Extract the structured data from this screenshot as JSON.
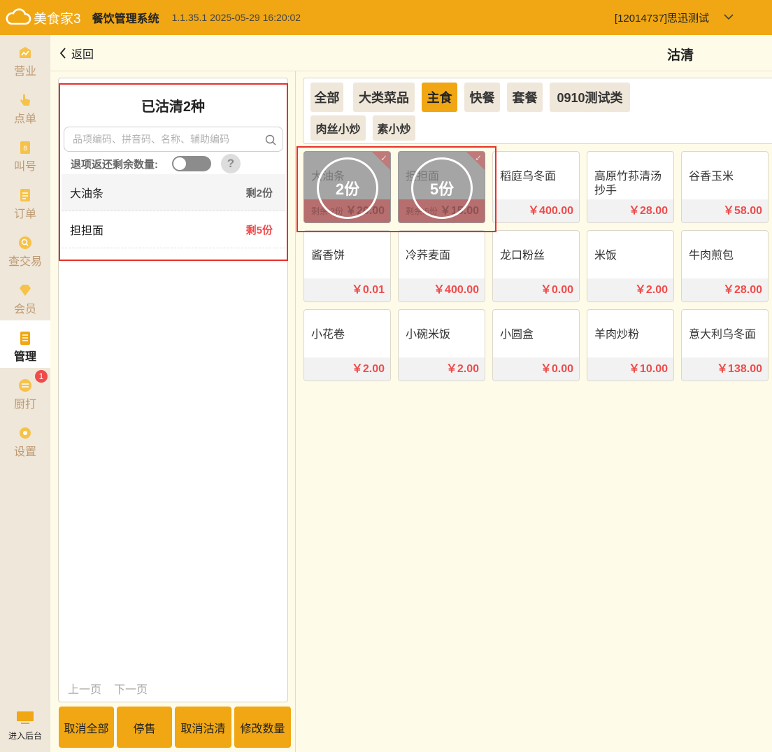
{
  "header": {
    "logo_text": "美食家3",
    "app_title": "餐饮管理系统",
    "version": "1.1.35.1 2025-05-29 16:20:02",
    "user": "[12014737]思迅测试"
  },
  "sidebar": {
    "items": [
      {
        "label": "营业",
        "icon": "chart-icon"
      },
      {
        "label": "点单",
        "icon": "hand-pointer-icon"
      },
      {
        "label": "叫号",
        "icon": "call-number-icon"
      },
      {
        "label": "订单",
        "icon": "order-icon"
      },
      {
        "label": "查交易",
        "icon": "search-transaction-icon"
      },
      {
        "label": "会员",
        "icon": "diamond-icon"
      },
      {
        "label": "管理",
        "icon": "clipboard-icon"
      },
      {
        "label": "厨打",
        "icon": "kitchen-print-icon"
      },
      {
        "label": "设置",
        "icon": "gear-icon"
      }
    ],
    "badge": "1",
    "backend_label": "进入后台"
  },
  "subheader": {
    "back_label": "返回",
    "title": "沽清"
  },
  "left_panel": {
    "title": "已沽清2种",
    "search_placeholder": "品项编码、拼音码、名称、辅助编码",
    "return_label": "退项返还剩余数量:",
    "help": "?",
    "items": [
      {
        "name": "大油条",
        "remain": "剩2份"
      },
      {
        "name": "担担面",
        "remain": "剩5份"
      }
    ],
    "prev_page": "上一页",
    "next_page": "下一页",
    "buttons": {
      "cancel_all": "取消全部",
      "stop_sale": "停售",
      "cancel_clear": "取消沽清",
      "modify_qty": "修改数量"
    }
  },
  "categories": [
    {
      "label": "全部"
    },
    {
      "label": "大类菜品"
    },
    {
      "label": "主食",
      "active": true
    },
    {
      "label": "快餐"
    },
    {
      "label": "套餐"
    },
    {
      "label": "0910测试类"
    },
    {
      "label": "肉丝小炒"
    },
    {
      "label": "素小炒"
    }
  ],
  "dishes": [
    {
      "name": "大油条",
      "price": "￥20.00",
      "remain": "剩余:2份",
      "circle": "2份",
      "sold": true
    },
    {
      "name": "担担面",
      "price": "￥15.00",
      "remain": "剩余:5份",
      "circle": "5份",
      "sold": true
    },
    {
      "name": "稻庭乌冬面",
      "price": "￥400.00"
    },
    {
      "name": "高原竹荪清汤抄手",
      "price": "￥28.00"
    },
    {
      "name": "谷香玉米",
      "price": "￥58.00"
    },
    {
      "name": "酱香饼",
      "price": "￥0.01"
    },
    {
      "name": "冷荞麦面",
      "price": "￥400.00"
    },
    {
      "name": "龙口粉丝",
      "price": "￥0.00"
    },
    {
      "name": "米饭",
      "price": "￥2.00"
    },
    {
      "name": "牛肉煎包",
      "price": "￥28.00"
    },
    {
      "name": "小花卷",
      "price": "￥2.00"
    },
    {
      "name": "小碗米饭",
      "price": "￥2.00"
    },
    {
      "name": "小圆盒",
      "price": "￥0.00"
    },
    {
      "name": "羊肉炒粉",
      "price": "￥10.00"
    },
    {
      "name": "意大利乌冬面",
      "price": "￥138.00"
    }
  ]
}
